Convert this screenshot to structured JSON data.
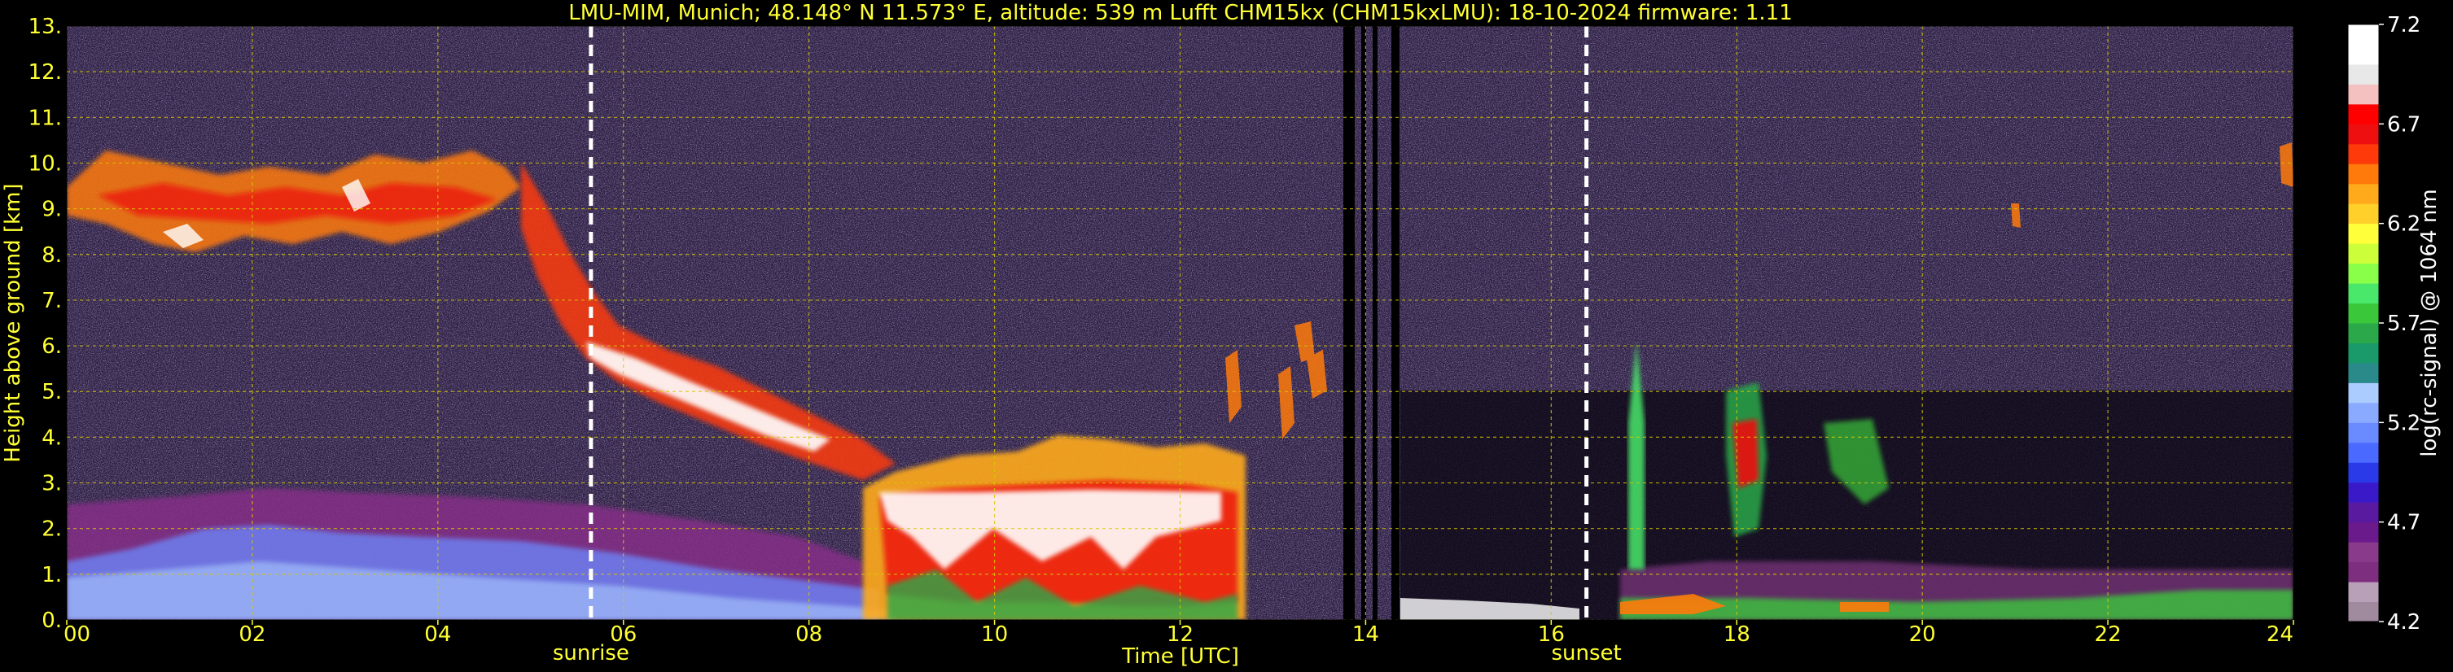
{
  "chart_data": {
    "type": "heatmap",
    "title": "LMU-MIM, Munich; 48.148° N 11.573° E, altitude: 539 m    Lufft CHM15kx (CHM15kxLMU): 18-10-2024    firmware: 1.11",
    "xlabel": "Time [UTC]",
    "ylabel": "Height above ground [km]",
    "xlim": [
      0,
      24
    ],
    "ylim": [
      0,
      13
    ],
    "xticks": [
      "00",
      "02",
      "04",
      "06",
      "08",
      "10",
      "12",
      "14",
      "16",
      "18",
      "20",
      "22",
      "24"
    ],
    "xtick_values": [
      0,
      2,
      4,
      6,
      8,
      10,
      12,
      14,
      16,
      18,
      20,
      22,
      24
    ],
    "yticks": [
      "0.",
      "1.",
      "2.",
      "3.",
      "4.",
      "5.",
      "6.",
      "7.",
      "8.",
      "9.",
      "10.",
      "11.",
      "12.",
      "13."
    ],
    "ytick_values": [
      0,
      1,
      2,
      3,
      4,
      5,
      6,
      7,
      8,
      9,
      10,
      11,
      12,
      13
    ],
    "grid": true,
    "annotations": [
      {
        "label": "sunrise",
        "x": 5.65
      },
      {
        "label": "sunset",
        "x": 16.38
      }
    ],
    "data_gaps": [
      [
        13.72,
        13.82
      ],
      [
        13.9,
        13.96
      ],
      [
        14.05,
        14.1
      ],
      [
        14.28,
        14.36
      ]
    ],
    "features": [
      {
        "kind": "cirrus",
        "x": [
          0.0,
          5.0
        ],
        "y": [
          8.0,
          10.4
        ]
      },
      {
        "kind": "descending_cloud",
        "x": [
          5.0,
          8.5
        ],
        "y": [
          3.5,
          8.0
        ]
      },
      {
        "kind": "mid_cloud",
        "x": [
          8.7,
          12.5
        ],
        "y": [
          0.2,
          3.8
        ]
      },
      {
        "kind": "boundary_layer",
        "x": [
          0.0,
          8.0
        ],
        "y": [
          0.0,
          2.6
        ]
      },
      {
        "kind": "convective_cells",
        "x": [
          16.9,
          19.5
        ],
        "y": [
          0.3,
          7.5
        ]
      },
      {
        "kind": "surface_layer",
        "x": [
          16.5,
          24.0
        ],
        "y": [
          0.0,
          1.2
        ]
      }
    ],
    "colorbar": {
      "label": "log(rc-signal) @ 1064 nm",
      "range": [
        4.2,
        7.2
      ],
      "ticks": [
        "7.2",
        "6.7",
        "6.2",
        "5.7",
        "5.2",
        "4.7",
        "4.2"
      ],
      "tick_values": [
        7.2,
        6.7,
        6.2,
        5.7,
        5.2,
        4.7,
        4.2
      ],
      "colors": [
        "#a08a9e",
        "#b8a0b8",
        "#7e2e7e",
        "#8a3a8a",
        "#6a1a8a",
        "#5a1aa0",
        "#3a1ac8",
        "#2a3ae8",
        "#4a6aff",
        "#6a8aff",
        "#8aaaff",
        "#aaccff",
        "#2a8a8a",
        "#1a9a6a",
        "#2aa84a",
        "#3ac83a",
        "#4ae86a",
        "#8aff4a",
        "#ccff3a",
        "#ffff3a",
        "#ffd02a",
        "#ffaa1a",
        "#ff7a0a",
        "#ff3a0a",
        "#ee1010",
        "#ff0000",
        "#f4c0c0",
        "#e8e8e8",
        "#ffffff",
        "#ffffff"
      ]
    }
  }
}
